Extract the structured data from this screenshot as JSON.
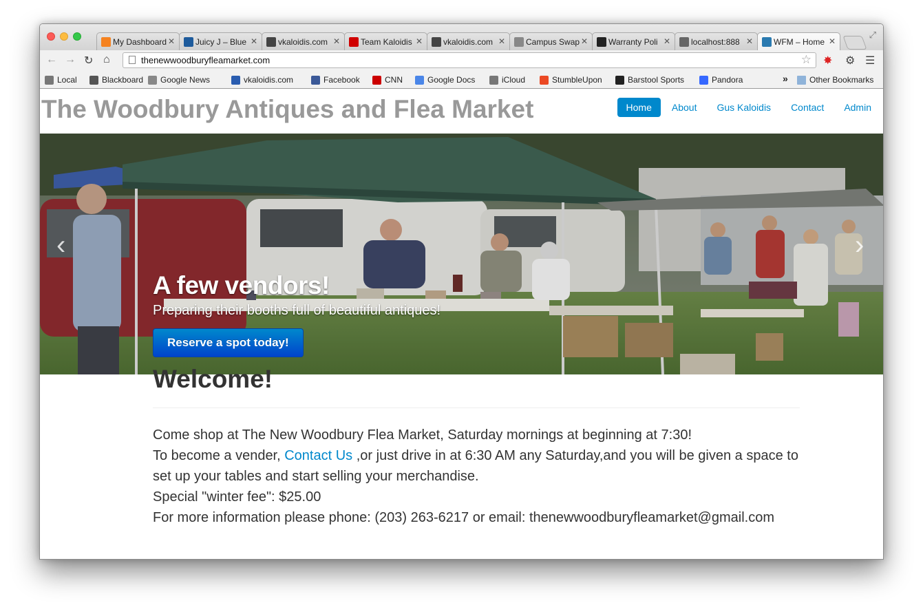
{
  "browser": {
    "tabs": [
      {
        "title": "My Dashboard",
        "icon": "dashboard-icon",
        "color": "#f58220"
      },
      {
        "title": "Juicy J – Blue",
        "icon": "globe-icon",
        "color": "#1e5b9c"
      },
      {
        "title": "vkaloidis.com",
        "icon": "vk-icon",
        "color": "#444444"
      },
      {
        "title": "Team Kaloidis",
        "icon": "espn-icon",
        "color": "#d00000"
      },
      {
        "title": "vkaloidis.com",
        "icon": "vk-icon",
        "color": "#444444"
      },
      {
        "title": "Campus Swap",
        "icon": "page-icon",
        "color": "#888888"
      },
      {
        "title": "Warranty Poli",
        "icon": "alien-icon",
        "color": "#222222"
      },
      {
        "title": "localhost:888",
        "icon": "globe-icon",
        "color": "#666666"
      },
      {
        "title": "WFM – Home",
        "icon": "hm-icon",
        "color": "#2a7ab0",
        "active": true
      }
    ],
    "url": "thenewwoodburyfleamarket.com",
    "bookmarks": [
      {
        "label": "Local",
        "icon": "globe-icon",
        "color": "#777777"
      },
      {
        "label": "Blackboard",
        "icon": "blackboard-icon",
        "color": "#555555"
      },
      {
        "label": "Google News",
        "icon": "news-icon",
        "color": "#888888"
      },
      {
        "label": "vkaloidis.com",
        "icon": "grid-icon",
        "color": "#2a5db0"
      },
      {
        "label": "Facebook",
        "icon": "facebook-icon",
        "color": "#3b5998"
      },
      {
        "label": "CNN",
        "icon": "cnn-icon",
        "color": "#cc0000"
      },
      {
        "label": "Google Docs",
        "icon": "docs-icon",
        "color": "#4a86e8"
      },
      {
        "label": "iCloud",
        "icon": "apple-icon",
        "color": "#777777"
      },
      {
        "label": "StumbleUpon",
        "icon": "stumbleupon-icon",
        "color": "#eb4924"
      },
      {
        "label": "Barstool Sports",
        "icon": "stool-icon",
        "color": "#222222"
      },
      {
        "label": "Pandora",
        "icon": "pandora-icon",
        "color": "#3668ff"
      }
    ],
    "other_bookmarks": "Other Bookmarks",
    "overflow": "»"
  },
  "site": {
    "title": "The Woodbury Antiques and Flea Market",
    "nav": [
      "Home",
      "About",
      "Gus Kaloidis",
      "Contact",
      "Admin"
    ],
    "active_nav": "Home"
  },
  "hero": {
    "heading": "A few vendors!",
    "subheading": "Preparing their booths full of beautiful antiques!",
    "button": "Reserve a spot today!",
    "prev": "‹",
    "next": "›"
  },
  "welcome": {
    "heading": "Welcome!",
    "line1": "Come shop at The New Woodbury Flea Market, Saturday mornings at beginning at 7:30!",
    "line2_pre": "To become a vender, ",
    "line2_link": "Contact Us",
    "line2_post": " ,or just drive in at 6:30 AM any Saturday,and you will be given a space to set up your tables and start selling your merchandise.",
    "line3": "Special \"winter fee\": $25.00",
    "line4": "For more information please phone: (203) 263-6217 or email: thenewwoodburyfleamarket@gmail.com"
  }
}
